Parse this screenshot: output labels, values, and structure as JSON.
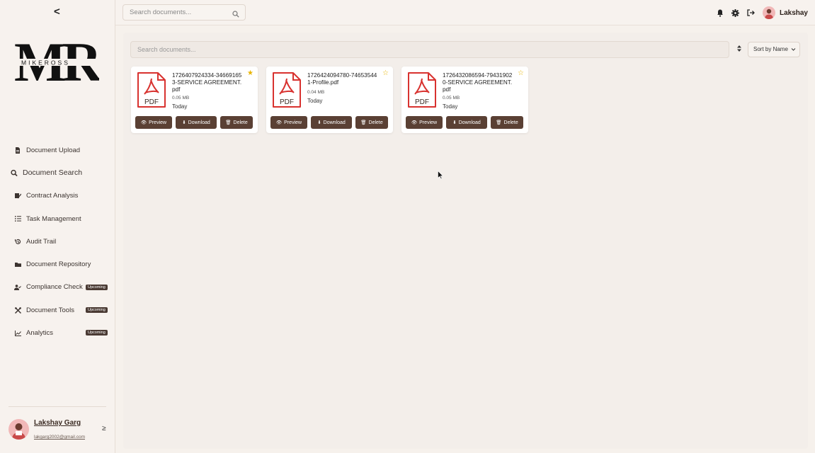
{
  "sidebar": {
    "collapse_label": "<",
    "logo_text": "MR",
    "logo_subtext": "MIKEROSS",
    "items": [
      {
        "label": "Document Upload",
        "icon": "file-icon"
      },
      {
        "label": "Document Search",
        "icon": "search-icon"
      },
      {
        "label": "Contract Analysis",
        "icon": "contract-icon"
      },
      {
        "label": "Task Management",
        "icon": "list-icon"
      },
      {
        "label": "Audit Trail",
        "icon": "history-icon"
      },
      {
        "label": "Document Repository",
        "icon": "folder-icon"
      },
      {
        "label": "Compliance Check",
        "icon": "user-check-icon",
        "badge": "Upcoming"
      },
      {
        "label": "Document Tools",
        "icon": "tools-icon",
        "badge": "Upcoming"
      },
      {
        "label": "Analytics",
        "icon": "chart-icon",
        "badge": "Upcoming"
      }
    ],
    "user": {
      "name": "Lakshay Garg",
      "email": "lakgarg2002@gmail.com",
      "expand_label": "≥"
    }
  },
  "topbar": {
    "search_placeholder": "Search documents...",
    "user_name": "Lakshay"
  },
  "main": {
    "search_placeholder": "Search documents...",
    "sort_label": "Sort by Name",
    "documents": [
      {
        "name": "1726407924334-346691653-SERVICE AGREEMENT.pdf",
        "size": "0.05 MB",
        "date": "Today",
        "starred": true
      },
      {
        "name": "1726424094780-746535441-Profile.pdf",
        "size": "0.04 MB",
        "date": "Today",
        "starred": false
      },
      {
        "name": "1726432086594-794319020-SERVICE AGREEMENT.pdf",
        "size": "0.05 MB",
        "date": "Today",
        "starred": false
      }
    ],
    "pdf_label": "PDF",
    "buttons": {
      "preview": "Preview",
      "download": "Download",
      "delete": "Delete"
    }
  },
  "colors": {
    "accent": "#5a4034",
    "star": "#e8b400",
    "pdf_red": "#d8322f"
  }
}
